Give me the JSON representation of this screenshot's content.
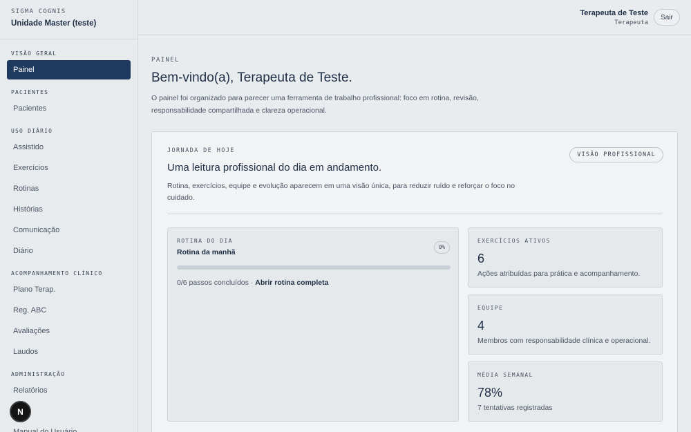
{
  "brand": {
    "kicker": "SIGMA COGNIS",
    "unit": "Unidade Master (teste)"
  },
  "sidebar": {
    "sections": [
      {
        "title": "VISÃO GERAL",
        "items": [
          {
            "label": "Painel",
            "active": true
          }
        ]
      },
      {
        "title": "PACIENTES",
        "items": [
          {
            "label": "Pacientes"
          }
        ]
      },
      {
        "title": "USO DIÁRIO",
        "items": [
          {
            "label": "Assistido"
          },
          {
            "label": "Exercícios"
          },
          {
            "label": "Rotinas"
          },
          {
            "label": "Histórias"
          },
          {
            "label": "Comunicação"
          },
          {
            "label": "Diário"
          }
        ]
      },
      {
        "title": "ACOMPANHAMENTO CLÍNICO",
        "items": [
          {
            "label": "Plano Terap."
          },
          {
            "label": "Reg. ABC"
          },
          {
            "label": "Avaliações"
          },
          {
            "label": "Laudos"
          }
        ]
      },
      {
        "title": "ADMINISTRAÇÃO",
        "items": [
          {
            "label": "Relatórios"
          },
          {
            "label": ""
          },
          {
            "label": "Manual do Usuário"
          }
        ]
      }
    ],
    "floating_badge": "N"
  },
  "header": {
    "user_name": "Terapeuta de Teste",
    "user_role": "Terapeuta",
    "logout_label": "Sair"
  },
  "page": {
    "kicker": "PAINEL",
    "title": "Bem-vindo(a), Terapeuta de Teste.",
    "description": "O painel foi organizado para parecer uma ferramenta de trabalho profissional: foco em rotina, revisão, responsabilidade compartilhada e clareza operacional."
  },
  "journey": {
    "kicker": "JORNADA DE HOJE",
    "title": "Uma leitura profissional do dia em andamento.",
    "description": "Rotina, exercícios, equipe e evolução aparecem em uma visão única, para reduzir ruído e reforçar o foco no cuidado.",
    "badge": "VISÃO PROFISSIONAL"
  },
  "routine": {
    "kicker": "ROTINA DO DIA",
    "title": "Rotina da manhã",
    "percent_label": "0%",
    "progress": 0,
    "status": "0/6 passos concluídos · ",
    "link": "Abrir rotina completa"
  },
  "stats": [
    {
      "kicker": "EXERCÍCIOS ATIVOS",
      "value": "6",
      "description": "Ações atribuídas para prática e acompanhamento."
    },
    {
      "kicker": "EQUIPE",
      "value": "4",
      "description": "Membros com responsabilidade clínica e operacional."
    },
    {
      "kicker": "MÉDIA SEMANAL",
      "value": "78%",
      "description": "7 tentativas registradas"
    }
  ],
  "colors": {
    "accent": "#1f3a5f",
    "background": "#e9ecef"
  }
}
